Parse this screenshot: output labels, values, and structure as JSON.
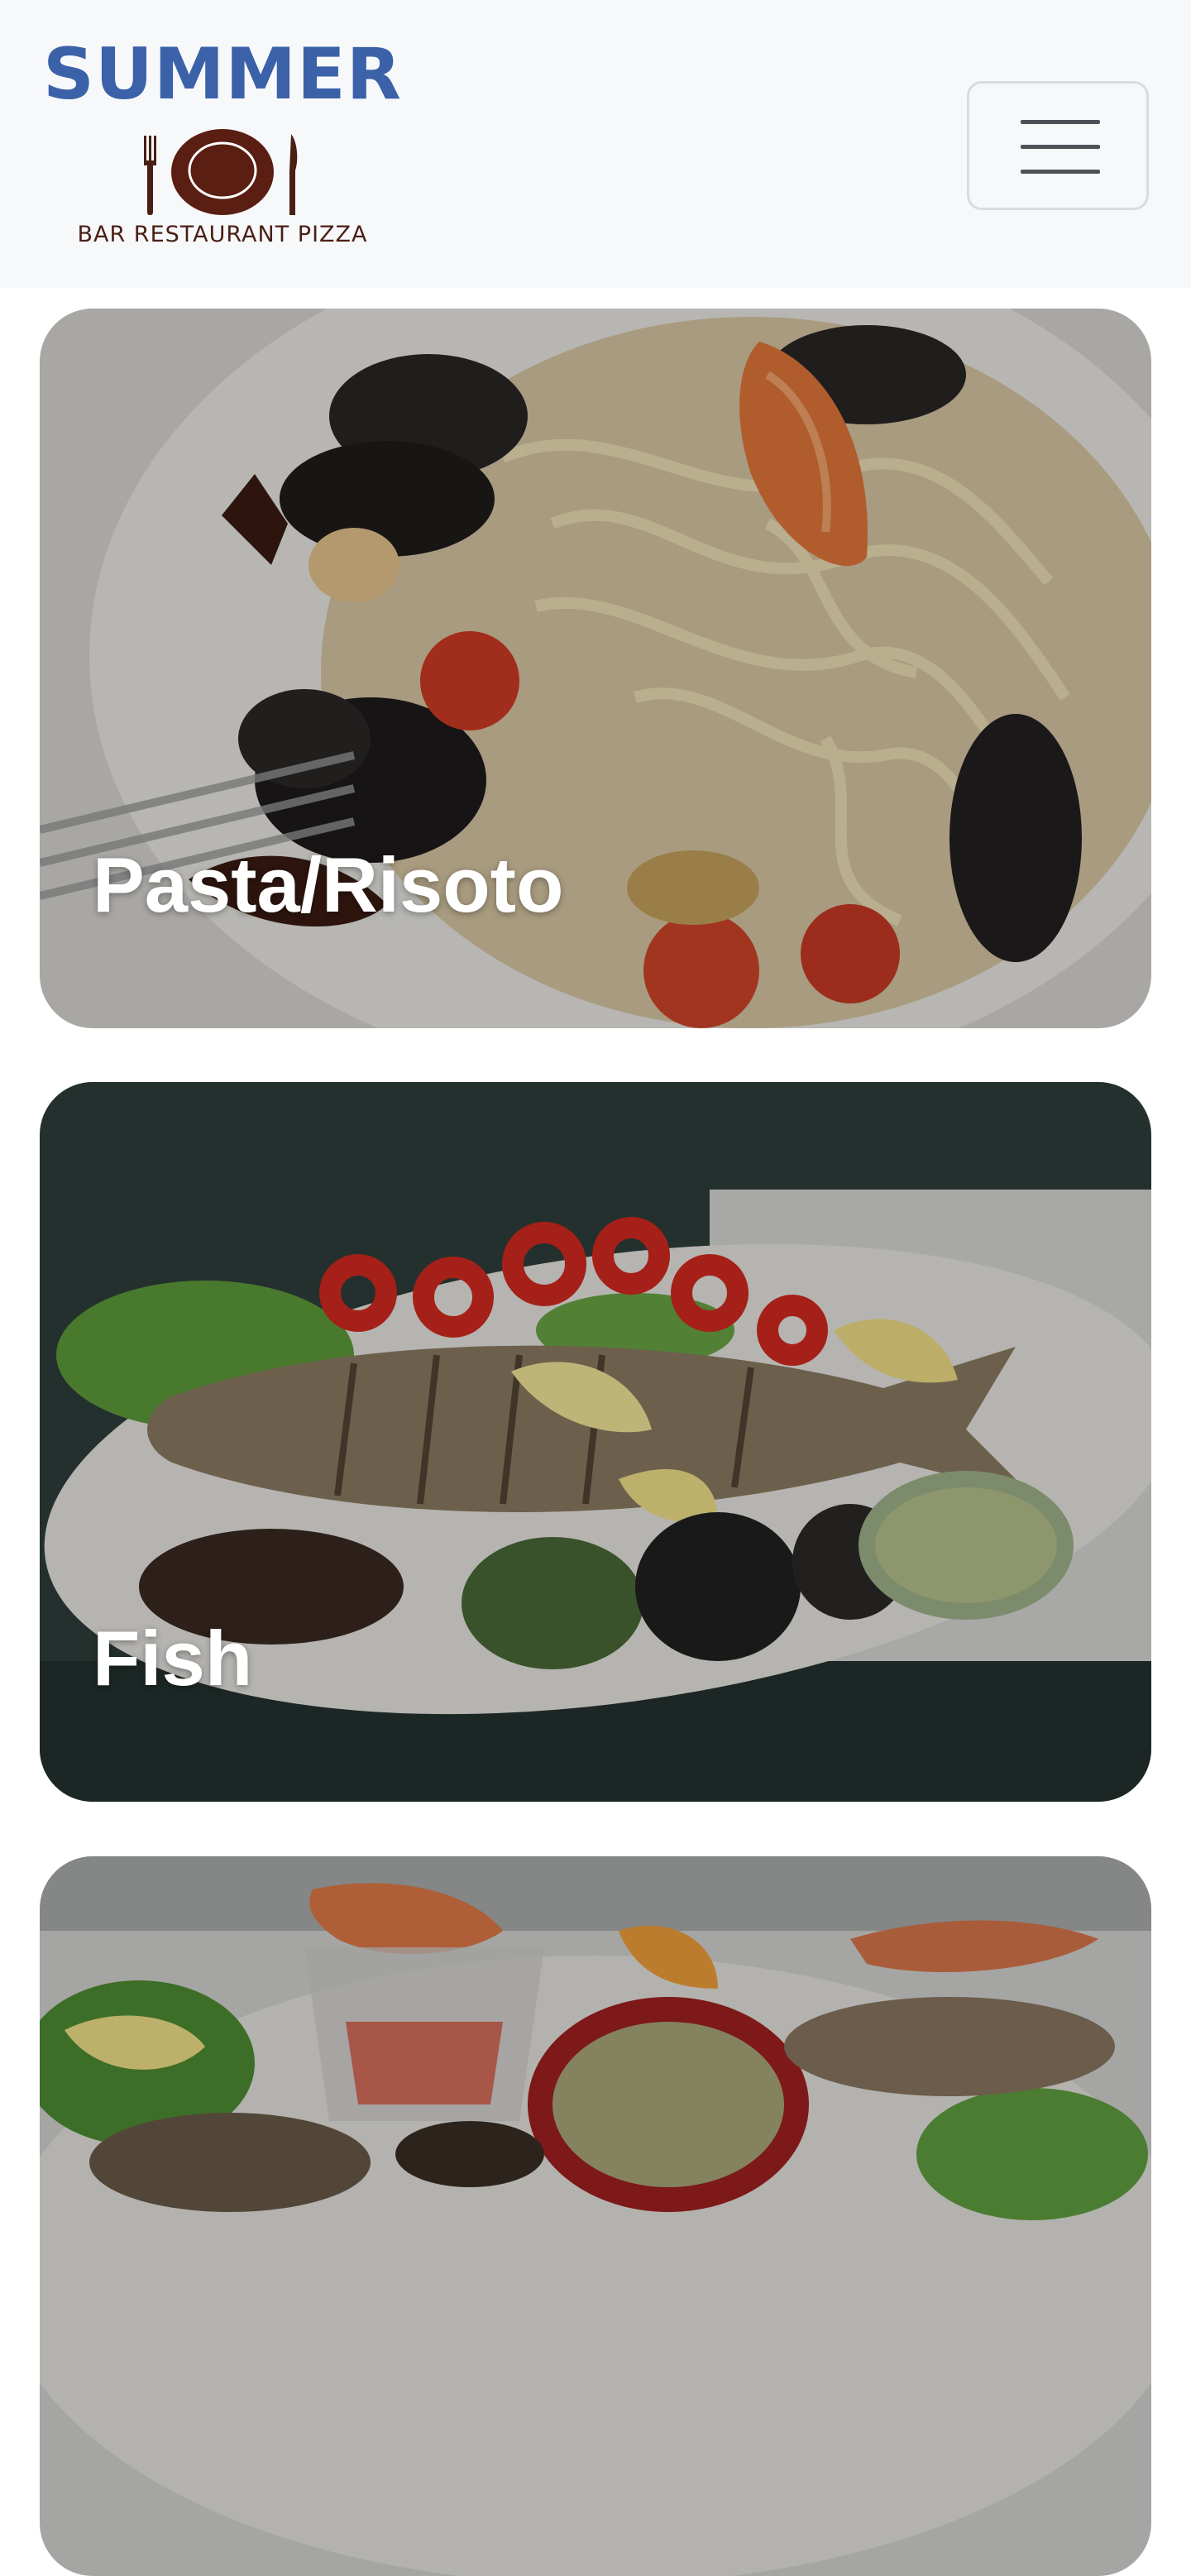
{
  "header": {
    "logo_title": "SUMMER",
    "logo_subtitle": "BAR RESTAURANT PIZZA",
    "logo_icon": "plate-fork-knife-icon",
    "menu_icon": "hamburger-menu-icon",
    "brand_color": "#3b62a8",
    "accent_color": "#4a1f15"
  },
  "categories": [
    {
      "label": "Pasta/Risoto",
      "image": "seafood-pasta-photo"
    },
    {
      "label": "Fish",
      "image": "grilled-fish-photo"
    },
    {
      "label": "",
      "image": "mixed-seafood-platter-photo"
    }
  ]
}
